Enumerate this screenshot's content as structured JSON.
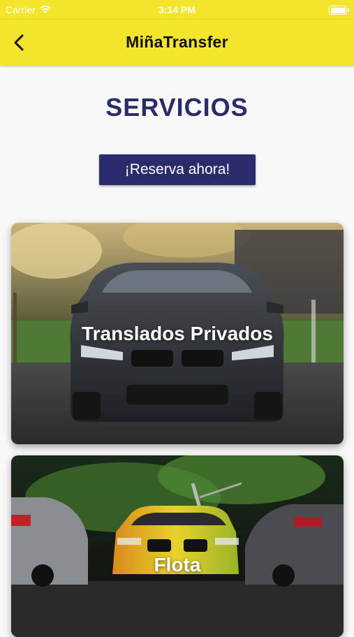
{
  "status_bar": {
    "carrier": "Carrier",
    "time": "3:14 PM"
  },
  "nav": {
    "title": "MiñaTransfer",
    "back_icon": "chevron-left-icon"
  },
  "main": {
    "heading": "SERVICIOS",
    "cta_label": "¡Reserva ahora!",
    "cards": [
      {
        "label": "Translados Privados"
      },
      {
        "label": "Flota"
      }
    ]
  },
  "colors": {
    "nav_background": "#f2e52b",
    "primary": "#2b2a6b",
    "page_background": "#f8f8f8"
  }
}
